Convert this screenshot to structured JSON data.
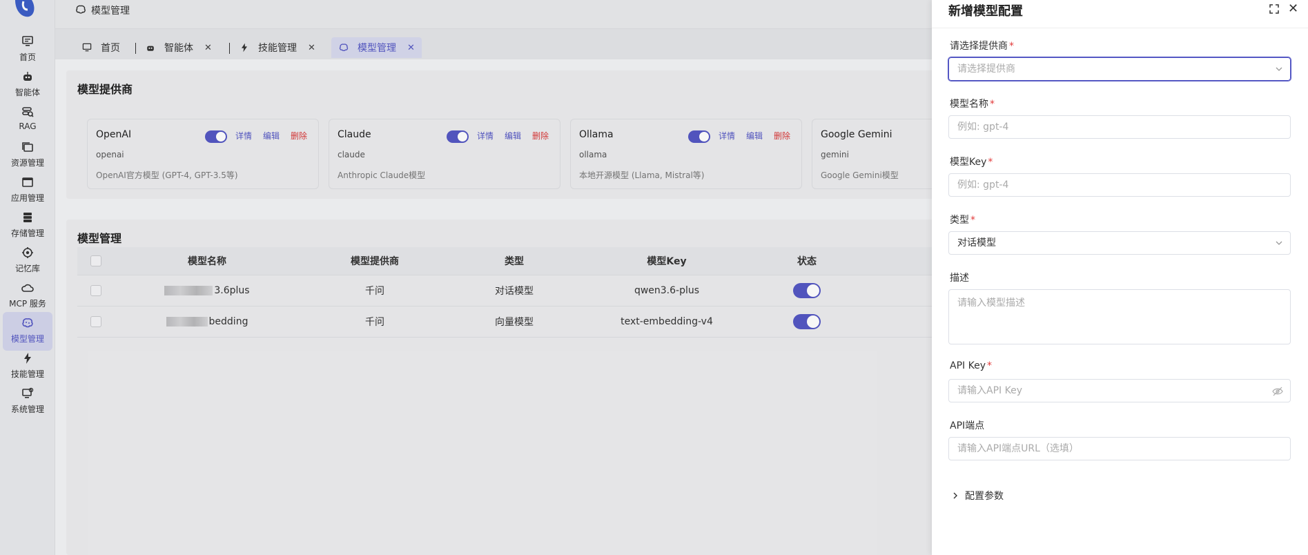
{
  "sidebar": {
    "items": [
      {
        "label": "首页",
        "icon": "monitor-icon"
      },
      {
        "label": "智能体",
        "icon": "robot-icon"
      },
      {
        "label": "RAG",
        "icon": "document-search-icon"
      },
      {
        "label": "资源管理",
        "icon": "folders-icon"
      },
      {
        "label": "应用管理",
        "icon": "window-icon"
      },
      {
        "label": "存储管理",
        "icon": "database-icon"
      },
      {
        "label": "记忆库",
        "icon": "memory-icon"
      },
      {
        "label": "MCP 服务",
        "icon": "cloud-icon"
      },
      {
        "label": "模型管理",
        "icon": "brain-icon",
        "active": true
      },
      {
        "label": "技能管理",
        "icon": "lightning-icon"
      },
      {
        "label": "系统管理",
        "icon": "settings-monitor-icon"
      }
    ]
  },
  "header": {
    "title": "模型管理"
  },
  "tabs": [
    {
      "label": "首页",
      "closable": false
    },
    {
      "label": "智能体",
      "closable": true
    },
    {
      "label": "技能管理",
      "closable": true
    },
    {
      "label": "模型管理",
      "closable": true,
      "active": true
    }
  ],
  "providers_section": {
    "title": "模型提供商",
    "actions": {
      "detail": "详情",
      "edit": "编辑",
      "delete": "删除"
    },
    "cards": [
      {
        "name": "OpenAI",
        "key": "openai",
        "desc": "OpenAI官方模型 (GPT-4, GPT-3.5等)",
        "enabled": true
      },
      {
        "name": "Claude",
        "key": "claude",
        "desc": "Anthropic Claude模型",
        "enabled": true
      },
      {
        "name": "Ollama",
        "key": "ollama",
        "desc": "本地开源模型 (Llama, Mistral等)",
        "enabled": true
      },
      {
        "name": "Google Gemini",
        "key": "gemini",
        "desc": "Google Gemini模型",
        "enabled": true
      }
    ]
  },
  "models_section": {
    "title": "模型管理",
    "columns": [
      "模型名称",
      "模型提供商",
      "类型",
      "模型Key",
      "状态"
    ],
    "rows": [
      {
        "name_suffix": "3.6plus",
        "provider": "千问",
        "type": "对话模型",
        "key": "qwen3.6-plus",
        "enabled": true
      },
      {
        "name_suffix": "bedding",
        "provider": "千问",
        "type": "向量模型",
        "key": "text-embedding-v4",
        "enabled": true
      }
    ]
  },
  "drawer": {
    "title": "新增模型配置",
    "provider": {
      "label": "请选择提供商",
      "placeholder": "请选择提供商",
      "required": "*"
    },
    "model_name": {
      "label": "模型名称",
      "placeholder": "例如: gpt-4",
      "required": "*"
    },
    "model_key": {
      "label": "模型Key",
      "placeholder": "例如: gpt-4",
      "required": "*"
    },
    "type": {
      "label": "类型",
      "value": "对话模型",
      "required": "*"
    },
    "description": {
      "label": "描述",
      "placeholder": "请输入模型描述"
    },
    "api_key": {
      "label": "API Key",
      "placeholder": "请输入API Key",
      "required": "*"
    },
    "api_endpoint": {
      "label": "API端点",
      "placeholder": "请输入API端点URL（选填）"
    },
    "config_params": {
      "label": "配置参数"
    }
  },
  "colors": {
    "accent": "#5457c4",
    "danger": "#d93a3a",
    "required": "#e23b3b"
  }
}
